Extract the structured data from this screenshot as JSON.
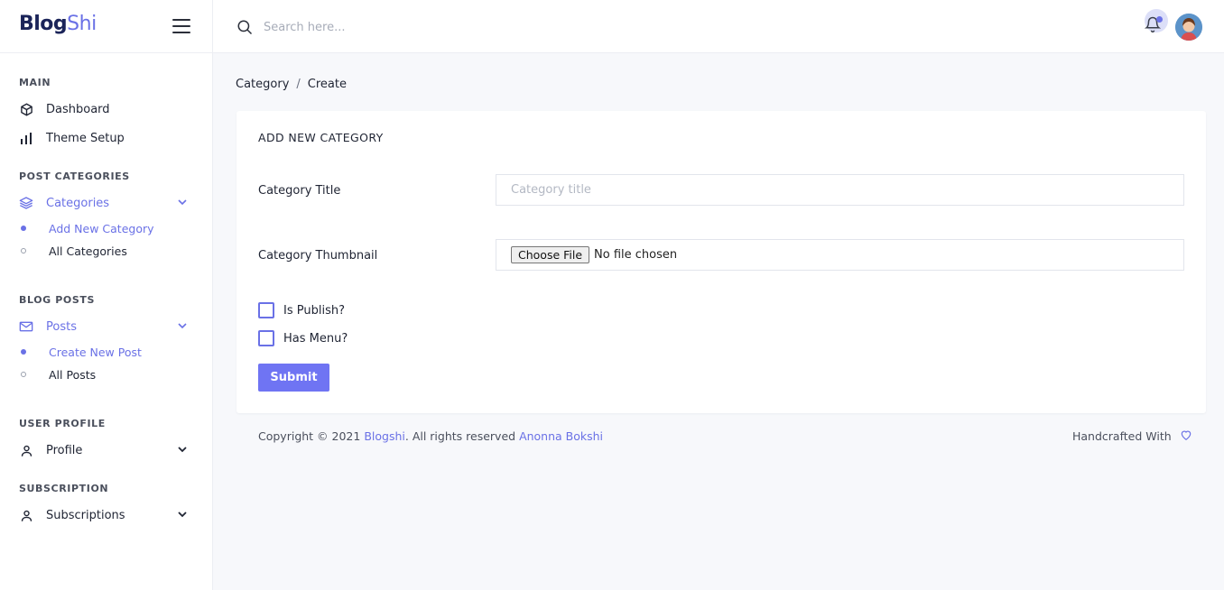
{
  "brand": {
    "part1": "Blog",
    "part2": "Shi"
  },
  "search": {
    "placeholder": "Search here..."
  },
  "sidebar": {
    "main_title": "MAIN",
    "dashboard": "Dashboard",
    "theme_setup": "Theme Setup",
    "post_categories_title": "POST CATEGORIES",
    "categories": "Categories",
    "add_new_category": "Add New Category",
    "all_categories": "All Categories",
    "blog_posts_title": "BLOG POSTS",
    "posts": "Posts",
    "create_new_post": "Create New Post",
    "all_posts": "All Posts",
    "user_profile_title": "USER PROFILE",
    "profile": "Profile",
    "subscription_title": "SUBSCRIPTION",
    "subscriptions": "Subscriptions"
  },
  "breadcrumb": {
    "parent": "Category",
    "separator": "/",
    "current": "Create"
  },
  "form": {
    "title": "ADD NEW CATEGORY",
    "category_title_label": "Category Title",
    "category_title_placeholder": "Category title",
    "category_title_value": "",
    "thumbnail_label": "Category Thumbnail",
    "choose_file": "Choose File",
    "file_status": "No file chosen",
    "is_publish": "Is Publish?",
    "has_menu": "Has Menu?",
    "submit": "Submit"
  },
  "footer": {
    "copyright_prefix": "Copyright © 2021",
    "site_link": "Blogshi",
    "rights": ". All rights reserved",
    "author_link": "Anonna Bokshi",
    "handcrafted": "Handcrafted With"
  },
  "colors": {
    "accent": "#6a71e6",
    "brand_dark": "#1b2459",
    "button": "#6f74f3"
  }
}
